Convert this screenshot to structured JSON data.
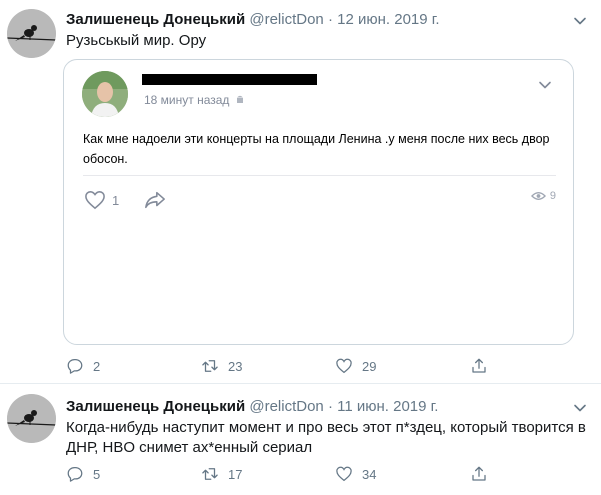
{
  "tweets": [
    {
      "author_name": "Залишенець Донецький",
      "handle": "@relictDon",
      "separator": "·",
      "date": "12 июн. 2019 г.",
      "text": "Рузьськый мир. Ору",
      "quoted": {
        "timestamp": "18 минут назад",
        "text": "Как мне надоели эти концерты на площади Ленина .у меня после них весь двор обосон.",
        "likes": "1",
        "views": "9"
      },
      "replies": "2",
      "retweets": "23",
      "likes": "29"
    },
    {
      "author_name": "Залишенець Донецький",
      "handle": "@relictDon",
      "separator": "·",
      "date": "11 июн. 2019 г.",
      "text": "Когда-нибудь наступит момент и про весь этот п*здец, который творится в ДНР, HBO снимет ах*енный сериал",
      "replies": "5",
      "retweets": "17",
      "likes": "34"
    }
  ],
  "colors": {
    "secondary": "#657786",
    "border": "#ccd6dd",
    "vk_gray": "#828a99"
  },
  "icons": [
    "reply-icon",
    "retweet-icon",
    "like-icon",
    "share-icon",
    "chevron-down-icon",
    "android-icon",
    "eye-icon"
  ]
}
